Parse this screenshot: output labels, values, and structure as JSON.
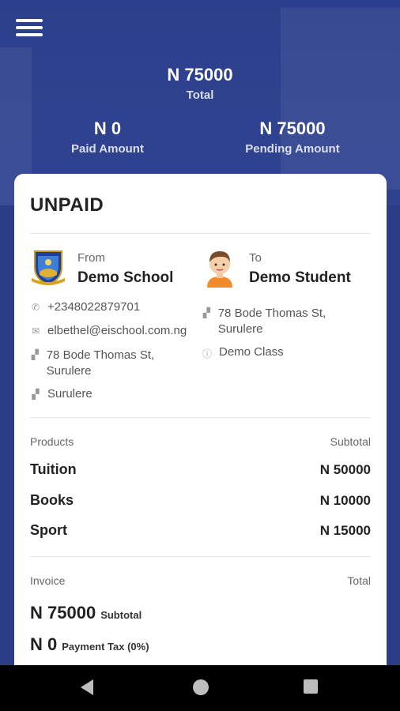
{
  "summary": {
    "total_value": "N 75000",
    "total_label": "Total",
    "paid_value": "N 0",
    "paid_label": "Paid Amount",
    "pending_value": "N 75000",
    "pending_label": "Pending Amount"
  },
  "invoice": {
    "status": "UNPAID",
    "from": {
      "label": "From",
      "name": "Demo School",
      "phone": "+2348022879701",
      "email": "elbethel@eischool.com.ng",
      "address": "78 Bode Thomas St, Surulere",
      "city": "Surulere"
    },
    "to": {
      "label": "To",
      "name": "Demo Student",
      "address": "78 Bode Thomas St, Surulere",
      "class": "Demo Class"
    },
    "products_header": "Products",
    "subtotal_header": "Subtotal",
    "products": [
      {
        "name": "Tuition",
        "amount": "N 50000"
      },
      {
        "name": "Books",
        "amount": "N 10000"
      },
      {
        "name": "Sport",
        "amount": "N 15000"
      }
    ],
    "invoice_header": "Invoice",
    "total_header": "Total",
    "subtotal_value": "N 75000",
    "subtotal_label": "Subtotal",
    "tax_value": "N 0",
    "tax_label": "Payment Tax (0%)"
  },
  "icons": {
    "menu": "menu-icon",
    "phone": "phone-icon",
    "email": "email-icon",
    "address": "location-icon",
    "class": "info-icon"
  },
  "colors": {
    "header_bg": "#2c3f8c",
    "card_bg": "#ffffff",
    "text": "#222222"
  }
}
